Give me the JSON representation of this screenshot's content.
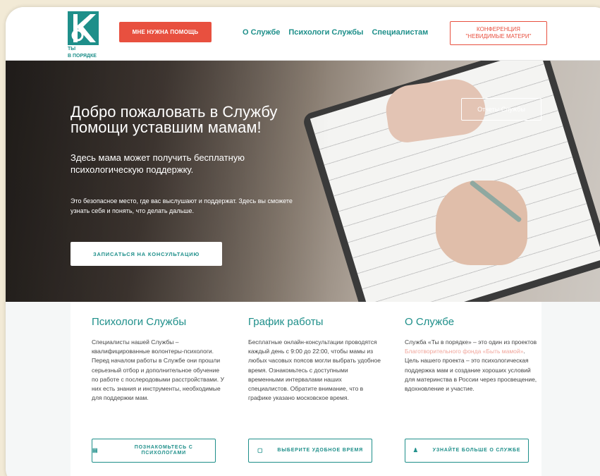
{
  "header": {
    "logo_text_1": "ТЫ",
    "logo_text_2": "В ПОРЯДКЕ",
    "help_button": "МНЕ НУЖНА ПОМОЩЬ",
    "nav": [
      "О Службе",
      "Психологи Службы",
      "Специалистам"
    ],
    "conference_line1": "КОНФЕРЕНЦИЯ",
    "conference_line2": "\"НЕВИДИМЫЕ МАТЕРИ\""
  },
  "hero": {
    "title": "Добро пожаловать в Службу помощи уставшим мамам!",
    "subtitle": "Здесь мама может получить бесплатную психологическую поддержку.",
    "text": "Это безопасное место, где вас выслушают и поддержат. Здесь вы сможете узнать себя и понять, что делать дальше.",
    "consult_button": "ЗАПИСАТЬСЯ НА КОНСУЛЬТАЦИЮ",
    "reports_button": "Отчеты Службы"
  },
  "columns": [
    {
      "title": "Психологи Службы",
      "text": "Специалисты нашей Службы – квалифицированные волонтеры-психологи. Перед началом работы в Службе они прошли серьезный отбор и дополнительное обучение по работе с послеродовыми расстройствами. У них есть знания и инструменты, необходимые для поддержки мам.",
      "button": "ПОЗНАКОМЬТЕСЬ С ПСИХОЛОГАМИ",
      "icon": "id-card-icon"
    },
    {
      "title": "График работы",
      "text": "Бесплатные онлайн-консультации проводятся каждый день с 9:00 до 22:00, чтобы мамы из любых часовых поясов могли выбрать удобное время. Ознакомьтесь с доступными временными интервалами наших специалистов. Обратите внимание, что в графике указано московское время.",
      "button": "ВЫБЕРИТЕ УДОБНОЕ ВРЕМЯ",
      "icon": "calendar-icon"
    },
    {
      "title": "О Службе",
      "text_before": "Служба «Ты в порядке» – это один из проектов ",
      "text_link": "Благотворительного фонда «Быть мамой»",
      "text_after": ". Цель нашего проекта – это психологическая поддержка мам и создание хороших условий для материнства в России через просвещение, вдохновление и участие.",
      "button": "УЗНАЙТЕ БОЛЬШЕ О СЛУЖБЕ",
      "icon": "bell-icon"
    }
  ],
  "colors": {
    "teal": "#1e8f8a",
    "red": "#e8503f",
    "link_pink": "#f0a59b"
  }
}
